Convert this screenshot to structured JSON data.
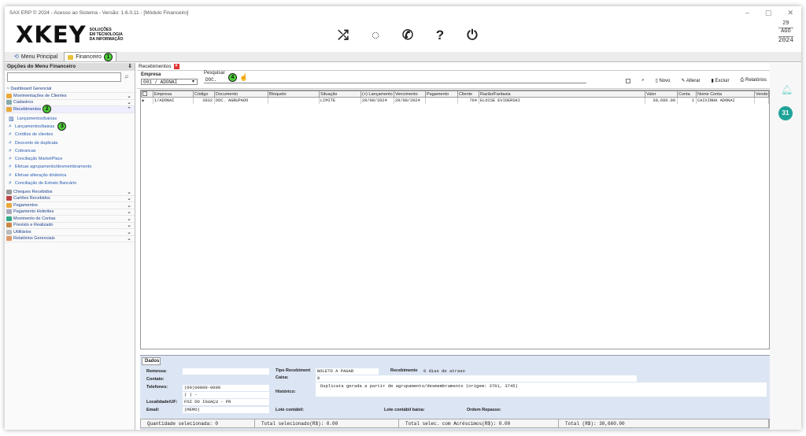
{
  "window": {
    "title": "SAX ERP © 2024 - Acesso ao Sistema - Versão: 1.6.0.11 - [Módulo Financeiro]",
    "controls": [
      "–",
      "▢",
      "✕"
    ]
  },
  "brand": {
    "logo": "XKEY",
    "tagline1": "SOLUÇÕES",
    "tagline2": "EM TECNOLOGIA",
    "tagline3": "DA INFORMAÇÃO"
  },
  "toolbar_icons": [
    "shuffle-icon",
    "chat-icon",
    "whatsapp-icon",
    "help-icon",
    "power-icon"
  ],
  "date": {
    "day": "29",
    "month": "AGO",
    "year": "2024"
  },
  "tabs": [
    {
      "label": "Menu Principal",
      "badge": ""
    },
    {
      "label": "Financeiro",
      "badge": "1"
    }
  ],
  "sidebar": {
    "title": "Opções do Menu Financeiro",
    "pin": "⇩",
    "dashboard": "Dashboard Gerencial",
    "groups_top": [
      {
        "label": "Movimentações de Clientes",
        "color": "#e8a83a"
      },
      {
        "label": "Cadastros",
        "color": "#8aa"
      }
    ],
    "recebimentos": {
      "label": "Recebimentos",
      "badge": "2"
    },
    "subitems": [
      {
        "label": "Lançamentos/baixas",
        "badge": ""
      },
      {
        "label": "Lançamentos/baixas",
        "badge": "3"
      },
      {
        "label": "Créditos de clientes",
        "badge": ""
      },
      {
        "label": "Desconto de duplicata",
        "badge": ""
      },
      {
        "label": "Cobrancas",
        "badge": ""
      },
      {
        "label": "Conciliação MarketPlace",
        "badge": ""
      },
      {
        "label": "Efetuar agrupamento/desmembramento",
        "badge": ""
      },
      {
        "label": "Efetuar alteração dinâmica",
        "badge": ""
      },
      {
        "label": "Conciliação de Extrato Bancário",
        "badge": ""
      }
    ],
    "groups_bottom": [
      {
        "label": "Cheques Recebidos",
        "color": "#999"
      },
      {
        "label": "Cartões Recebidos",
        "color": "#b44"
      },
      {
        "label": "Pagamentos",
        "color": "#e8a83a"
      },
      {
        "label": "Pagamento Holerites",
        "color": "#aab"
      },
      {
        "label": "Movimento de Contas",
        "color": "#3a8"
      },
      {
        "label": "Previsto e Realizado",
        "color": "#c84"
      },
      {
        "label": "Utilitários",
        "color": "#bbb"
      },
      {
        "label": "Relatórios Gerenciais",
        "color": "#d96"
      }
    ]
  },
  "doc": {
    "tab": "Recebimentos",
    "empresa_label": "Empresa",
    "empresa_value": "001 / ADONAI",
    "pesquisar_label": "Pesquisar",
    "pesquisar_value": "DOC.",
    "badge": "4",
    "tools": [
      "Novo",
      "Alterar",
      "Excluir",
      "Relatórios"
    ]
  },
  "grid": {
    "columns": [
      "Empresa",
      "Código",
      "Documento",
      "Bloqueto",
      "Situação",
      "(+) Lançamento",
      "Vencimento",
      "Pagamento",
      "Cliente",
      "Razão/Fantasia",
      "Valor",
      "Conta",
      "Nome Conta",
      "Vendedor"
    ],
    "rows": [
      [
        "1/ADONAI",
        "3932",
        "DOC. AGRUPADO",
        "",
        "LIMITE",
        "29/08/2024",
        "29/08/2024",
        "",
        "764",
        "ELOISE EVIDERSKI",
        "30,660.00",
        "1",
        "CAIXINHA ADONAI",
        ""
      ]
    ]
  },
  "details": {
    "tab": "Dados",
    "remessa_label": "Remessa:",
    "remessa": "",
    "contato_label": "Contato:",
    "contato": "",
    "telefones_label": "Telefones:",
    "tel1": "(00)00000-0000",
    "tel2": "(  )      -",
    "localidade_label": "Localidade/UF:",
    "localidade": "FOZ DO IGUAÇU - PR",
    "email_label": "Email:",
    "email": "(MEMO)",
    "tipo_label": "Tipo Recebiment",
    "tipo": "BOLETO A PAGAR",
    "caixa_label": "Caixa:",
    "caixa": "0",
    "recebimento_label": "Recebimento",
    "recebimento": "0 dias de atraso",
    "historico_label": "Histórico:",
    "historico": "Duplicata gerada a partir de agrupamento/desmembramento  (origem:  3761, 3745)",
    "lote_label": "Lote contábil:",
    "lote_baixa_label": "Lote contábil baixa:",
    "ordem_label": "Ordem Repasse:"
  },
  "status": [
    "Quantidade selecionada: 0",
    "Total selecionado(R$): 0.00",
    "Total selec. com Acréscimos(R$): 0.00",
    "Total (R$): 30,660.00"
  ]
}
